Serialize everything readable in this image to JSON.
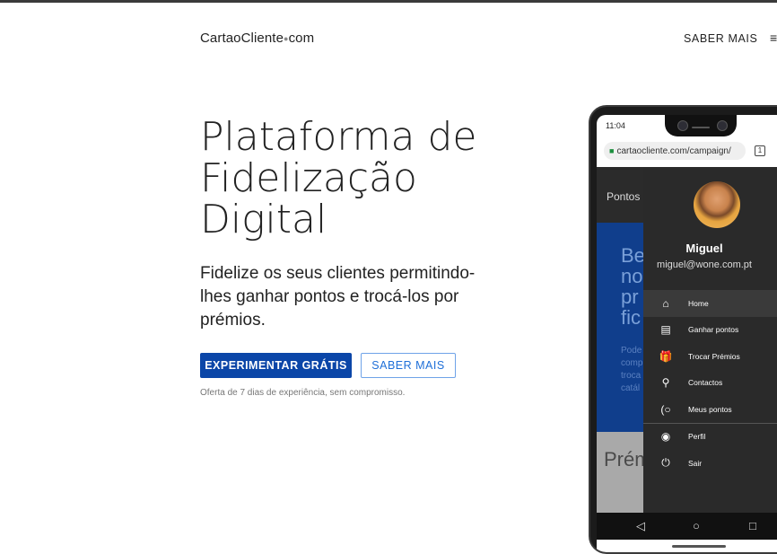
{
  "header": {
    "logo_main": "CartaoCliente",
    "logo_dot": "●",
    "logo_tail": "com",
    "nav_label": "SABER MAIS",
    "nav_more": "≡"
  },
  "hero": {
    "title_lines": [
      "Plataforma de",
      "Fidelização",
      "Digital"
    ],
    "subtitle": "Fidelize os seus clientes permitindo-lhes ganhar pontos e trocá-los por prémios.",
    "primary_button": "EXPERIMENTAR GRÁTIS",
    "secondary_button": "SABER MAIS",
    "trial_note": "Oferta de 7 dias de experiência, sem compromisso."
  },
  "phone": {
    "time": "11:04",
    "signal": "▾◢",
    "url": "cartaocliente.com/campaign/",
    "tab_count": "1",
    "app_header_title": "Pontos",
    "panel_big": "Be\nno\npr\nfic",
    "panel_small": "Pode\ncomp\ntroca\ncatál",
    "gray_title": "Prém",
    "user": {
      "name": "Miguel",
      "email": "miguel@wone.com.pt"
    },
    "menu": [
      {
        "label": "Home",
        "icon": "home-icon",
        "glyph": "⌂"
      },
      {
        "label": "Ganhar pontos",
        "icon": "gift-card-icon",
        "glyph": "▤"
      },
      {
        "label": "Trocar Prémios",
        "icon": "gift-icon",
        "glyph": "🎁"
      },
      {
        "label": "Contactos",
        "icon": "location-pin-icon",
        "glyph": "⚲"
      },
      {
        "label": "Meus pontos",
        "icon": "points-icon",
        "glyph": "(○"
      },
      {
        "label": "Perfil",
        "icon": "account-icon",
        "glyph": "◉"
      },
      {
        "label": "Sair",
        "icon": "power-icon",
        "glyph": "⏻"
      }
    ],
    "nav_back": "◁",
    "nav_home": "○",
    "nav_recent": "□"
  },
  "colors": {
    "primary": "#0b46a8",
    "outline": "#1e6fd8",
    "drawer": "#2a2a2a",
    "panel": "#103e8c"
  }
}
